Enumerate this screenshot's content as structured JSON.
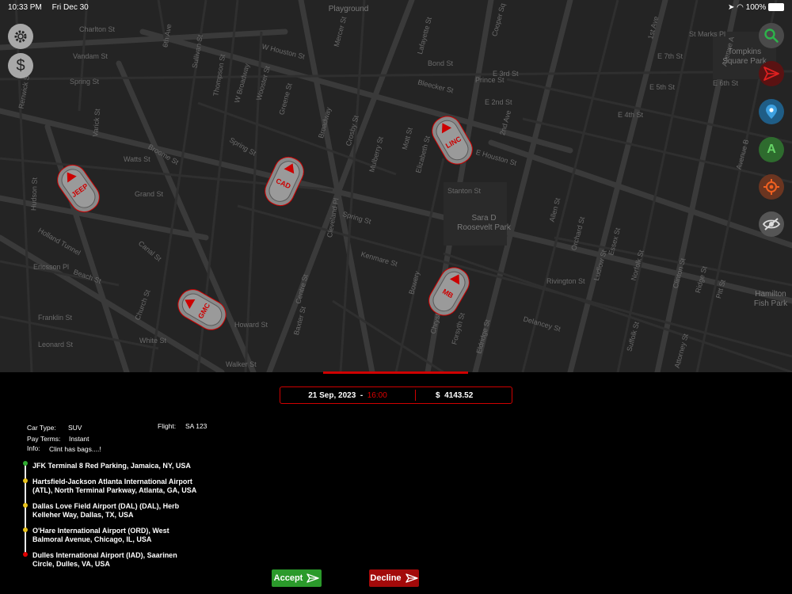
{
  "status": {
    "time": "10:33 PM",
    "date": "Fri Dec 30",
    "battery": "100%"
  },
  "map": {
    "streets": [
      "Charlton St",
      "Vandam St",
      "Spring St",
      "Watts St",
      "Broome St",
      "Grand St",
      "Canal St",
      "Walker St",
      "Leonard St",
      "Franklin St",
      "White St",
      "Howard St",
      "Kenmare St",
      "Delancey St",
      "E Houston St",
      "W Houston St",
      "Bleecker St",
      "Prince St",
      "Bond St",
      "E 2nd St",
      "E 3rd St",
      "E 4th St",
      "E 5th St",
      "E 6th St",
      "E 7th St",
      "St Marks Pl",
      "Stanton St",
      "Rivington St",
      "Broadway",
      "Lafayette St",
      "Bowery",
      "Chrystie St",
      "Forsyth St",
      "Eldridge St",
      "Allen St",
      "Orchard St",
      "Ludlow St",
      "Essex St",
      "Norfolk St",
      "Suffolk St",
      "Clinton St",
      "Attorney St",
      "Ridge St",
      "Pitt St",
      "Mott St",
      "Mulberry St",
      "Elizabeth St",
      "Centre St",
      "Baxter St",
      "Crosby St",
      "Mercer St",
      "Greene St",
      "Wooster St",
      "W Broadway",
      "Thompson St",
      "Sullivan St",
      "6th Ave",
      "Varick St",
      "Hudson St",
      "Renwick St",
      "Avenue A",
      "Avenue B",
      "1st Ave",
      "2nd Ave",
      "Cooper Sq",
      "Spring St",
      "Ericsson Pl",
      "Beach St",
      "Church St",
      "Cleveland Pl",
      "Spring St",
      "Holland Tunnel"
    ],
    "places": [
      "Tompkins Square Park",
      "Sara D Roosevelt Park",
      "Hamilton Fish Park",
      "Playground"
    ]
  },
  "cars": [
    {
      "logo": "JEEP"
    },
    {
      "logo": "CAD"
    },
    {
      "logo": "LINC"
    },
    {
      "logo": "GMC"
    },
    {
      "logo": "MB"
    }
  ],
  "trip": {
    "date": "21 Sep, 2023",
    "dash": "-",
    "time": "16:00",
    "currency": "$",
    "price": "4143.52",
    "car_type_label": "Car Type:",
    "car_type": "SUV",
    "flight_label": "Flight:",
    "flight": "SA 123",
    "pay_terms_label": "Pay Terms:",
    "pay_terms": "Instant",
    "info_label": "Info:",
    "info": "Clint has bags....!"
  },
  "stops": [
    {
      "line1": "JFK Terminal 8 Red Parking, Jamaica, NY, USA",
      "line2": "",
      "color": "#2faa2f"
    },
    {
      "line1": "Hartsfield-Jackson Atlanta International Airport",
      "line2": "(ATL), North Terminal Parkway, Atlanta, GA, USA",
      "color": "#e8c21c"
    },
    {
      "line1": "Dallas Love Field Airport (DAL) (DAL), Herb",
      "line2": "Kelleher Way, Dallas, TX, USA",
      "color": "#e8c21c"
    },
    {
      "line1": "O'Hare International Airport (ORD), West",
      "line2": "Balmoral Avenue, Chicago, IL, USA",
      "color": "#e8c21c"
    },
    {
      "line1": "Dulles International Airport (IAD), Saarinen",
      "line2": "Circle, Dulles, VA, USA",
      "color": "#e00000"
    }
  ],
  "actions": {
    "accept": "Accept",
    "decline": "Decline"
  },
  "right_buttons": {
    "avatar_letter": "A"
  },
  "colors": {
    "accent_red": "#d00000",
    "accept_green": "#2b9a2b",
    "decline_red": "#a30a0a"
  }
}
